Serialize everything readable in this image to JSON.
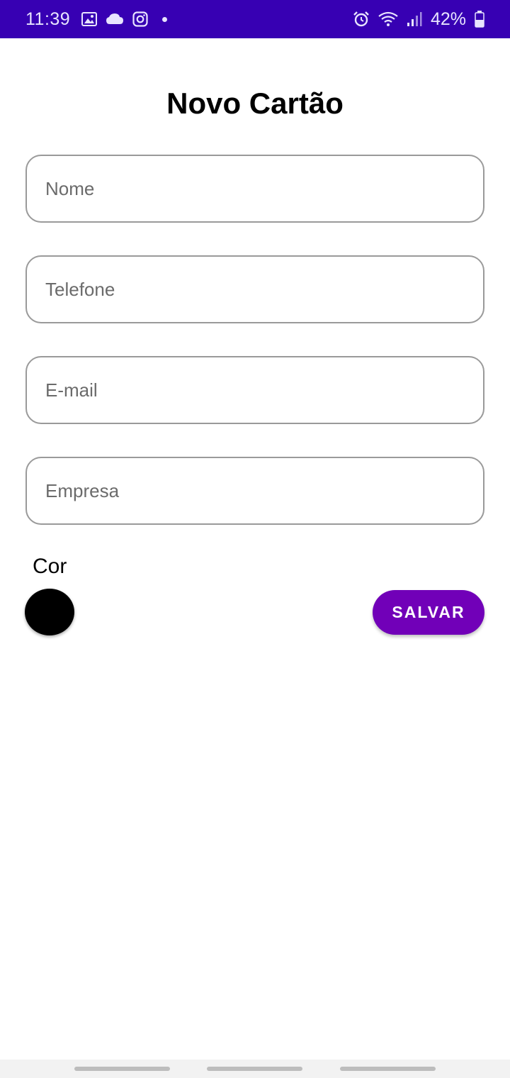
{
  "status_bar": {
    "time": "11:39",
    "battery": "42%",
    "left_icons": [
      "image-icon",
      "cloud-icon",
      "instagram-icon",
      "notification-dot-icon"
    ],
    "right_icons": [
      "alarm-icon",
      "wifi-icon",
      "signal-icon",
      "battery-icon"
    ]
  },
  "form": {
    "title": "Novo Cartão",
    "fields": {
      "name": {
        "placeholder": "Nome",
        "value": ""
      },
      "phone": {
        "placeholder": "Telefone",
        "value": ""
      },
      "email": {
        "placeholder": "E-mail",
        "value": ""
      },
      "company": {
        "placeholder": "Empresa",
        "value": ""
      }
    },
    "color_label": "Cor",
    "selected_color": "#000000",
    "save_label": "SALVAR"
  },
  "colors": {
    "status_bar": "#3700b3",
    "accent": "#7100b8"
  }
}
